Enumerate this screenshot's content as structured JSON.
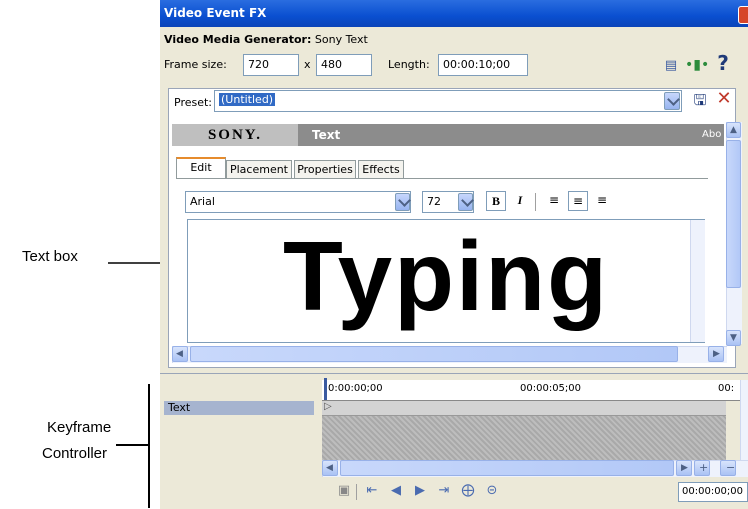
{
  "window": {
    "title": "Video Event FX"
  },
  "generator": {
    "label": "Video Media Generator:",
    "value": "Sony Text"
  },
  "frame": {
    "label": "Frame size:",
    "width": "720",
    "x": "x",
    "height": "480",
    "length_label": "Length:",
    "length_value": "00:00:10;00"
  },
  "preset": {
    "label": "Preset:",
    "value": "(Untitled)"
  },
  "plugin": {
    "brand": "SONY.",
    "name": "Text",
    "about": "Abo"
  },
  "tabs": [
    "Edit",
    "Placement",
    "Properties",
    "Effects"
  ],
  "format": {
    "font": "Arial",
    "size": "72",
    "bold": "B",
    "italic": "I"
  },
  "textbox": {
    "content": "Typing"
  },
  "timeline": {
    "t0": "0:00:00;00",
    "t1": "00:00:05;00",
    "t2": "00:",
    "track": "Text",
    "time_display": "00:00:00;00"
  },
  "annotations": {
    "text_box": "Text box",
    "keyframe_line1": "Keyframe",
    "keyframe_line2": "Controller"
  },
  "colors": {
    "titlebar": "#0a4fd0",
    "panel_bg": "#ece9d8",
    "selection": "#316ac5",
    "sony_bar": "#8c8c8c"
  }
}
